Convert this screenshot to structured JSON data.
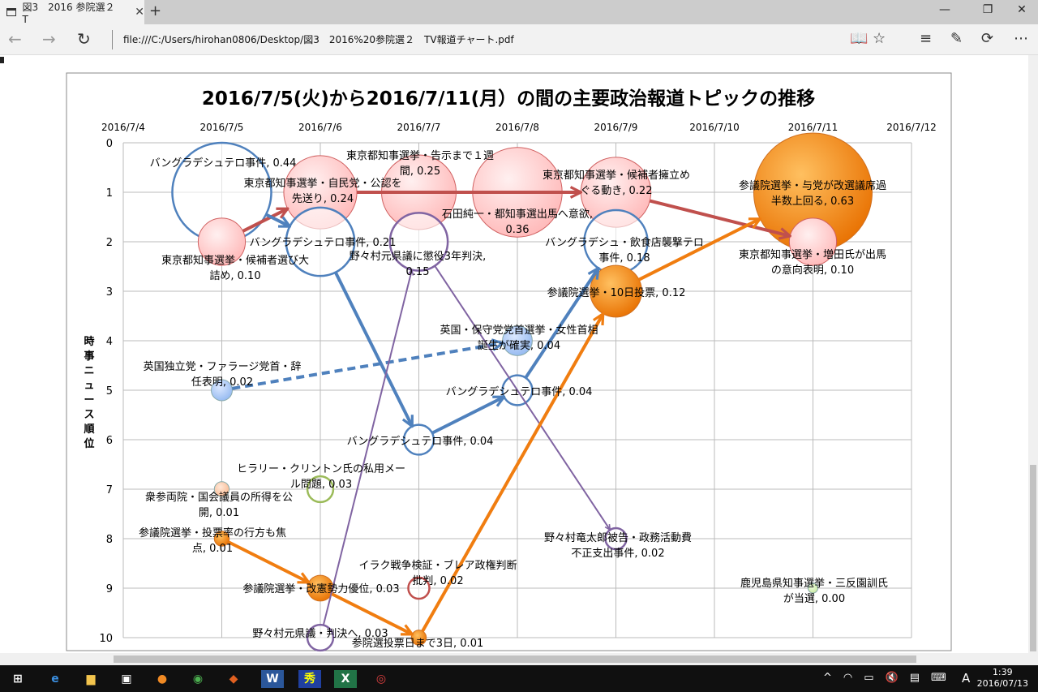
{
  "browser": {
    "tab_title": "図3　2016 参院選２　T",
    "url": "file:///C:/Users/hirohan0806/Desktop/図3　2016%20参院選２　TV報道チャート.pdf",
    "icons": [
      "tab-icon",
      "close-icon",
      "new-tab-icon",
      "minimize-icon",
      "maximize-icon",
      "close-window-icon",
      "back-icon",
      "forward-icon",
      "refresh-icon",
      "reading-view-icon",
      "favorite-star-icon",
      "hub-icon",
      "web-note-icon",
      "share-icon",
      "more-icon"
    ]
  },
  "taskbar": {
    "time": "1:39",
    "date": "2016/07/13",
    "ime": "A",
    "apps": [
      "start",
      "edge",
      "file-explorer",
      "store",
      "firefox",
      "chrome",
      "app",
      "word",
      "app",
      "excel",
      "app"
    ]
  },
  "chart_data": {
    "type": "bubble",
    "title": "2016/7/5(火)から2016/7/11(月）の間の主要政治報道トピックの推移",
    "ylabel": "時事ニュース順位",
    "xlabel": "",
    "x_ticks": [
      "2016/7/4",
      "2016/7/5",
      "2016/7/6",
      "2016/7/7",
      "2016/7/8",
      "2016/7/9",
      "2016/7/10",
      "2016/7/11",
      "2016/7/12"
    ],
    "y_ticks": [
      "0",
      "1",
      "2",
      "3",
      "4",
      "5",
      "6",
      "7",
      "8",
      "9",
      "10"
    ],
    "xlim": [
      "2016/7/4",
      "2016/7/12"
    ],
    "ylim": [
      0,
      10
    ],
    "y_reversed": true,
    "grid": true,
    "colors": {
      "red": "#c0504d",
      "pink": "#ffc7c7",
      "blue": "#4f81bd",
      "lightblue": "#a8c8f8",
      "purple": "#8064a2",
      "orange": "#f07d10",
      "lightorange": "#fbc8a0",
      "green": "#9bbb59",
      "lightgreen": "#d7f0b0"
    },
    "points": [
      {
        "date": "2016/7/5",
        "rank": 1,
        "value": 0.44,
        "style": "blue-outline",
        "label": [
          "バングラデシュテロ事件, 0.44"
        ]
      },
      {
        "date": "2016/7/5",
        "rank": 2,
        "value": 0.1,
        "style": "pink",
        "label": [
          "東京都知事選挙・候補者選び大",
          "詰め, 0.10"
        ]
      },
      {
        "date": "2016/7/6",
        "rank": 1,
        "value": 0.24,
        "style": "pink",
        "label": [
          "東京都知事選挙・自民党・公認を",
          "先送り, 0.24"
        ]
      },
      {
        "date": "2016/7/6",
        "rank": 2,
        "value": 0.21,
        "style": "blue-outline",
        "label": [
          "バングラデシュテロ事件, 0.21"
        ]
      },
      {
        "date": "2016/7/7",
        "rank": 1,
        "value": 0.25,
        "style": "pink",
        "label": [
          "東京都知事選挙・告示まで１週",
          "間, 0.25"
        ]
      },
      {
        "date": "2016/7/7",
        "rank": 2,
        "value": 0.15,
        "style": "purple-outline",
        "label": [
          "野々村元県議に懲役3年判決,",
          "0.15"
        ]
      },
      {
        "date": "2016/7/8",
        "rank": 1,
        "value": 0.36,
        "style": "pink",
        "label": [
          "石田純一・都知事選出馬へ意欲,",
          "0.36"
        ]
      },
      {
        "date": "2016/7/9",
        "rank": 1,
        "value": 0.22,
        "style": "pink",
        "label": [
          "東京都知事選挙・候補者擁立め",
          "ぐる動き, 0.22"
        ]
      },
      {
        "date": "2016/7/9",
        "rank": 2,
        "value": 0.18,
        "style": "blue-outline",
        "label": [
          "バングラデシュ・飲食店襲撃テロ",
          "事件, 0.18"
        ]
      },
      {
        "date": "2016/7/9",
        "rank": 3,
        "value": 0.12,
        "style": "orange",
        "label": [
          "参議院選挙・10日投票, 0.12"
        ]
      },
      {
        "date": "2016/7/11",
        "rank": 1,
        "value": 0.63,
        "style": "orange",
        "label": [
          "参議院選挙・与党が改選議席過",
          "半数上回る, 0.63"
        ]
      },
      {
        "date": "2016/7/11",
        "rank": 2,
        "value": 0.1,
        "style": "pink",
        "label": [
          "東京都知事選挙・増田氏が出馬",
          "の意向表明, 0.10"
        ]
      },
      {
        "date": "2016/7/8",
        "rank": 4,
        "value": 0.04,
        "style": "lightblue",
        "label": [
          "英国・保守党党首選挙・女性首相",
          "誕生が確実, 0.04"
        ]
      },
      {
        "date": "2016/7/5",
        "rank": 5,
        "value": 0.02,
        "style": "lightblue",
        "label": [
          "英国独立党・ファラージ党首・辞",
          "任表明, 0.02"
        ]
      },
      {
        "date": "2016/7/8",
        "rank": 5,
        "value": 0.04,
        "style": "blue-outline",
        "label": [
          "バングラデシュテロ事件, 0.04"
        ]
      },
      {
        "date": "2016/7/7",
        "rank": 6,
        "value": 0.04,
        "style": "blue-outline",
        "label": [
          "バングラデシュテロ事件, 0.04"
        ]
      },
      {
        "date": "2016/7/6",
        "rank": 7,
        "value": 0.03,
        "style": "green-outline",
        "label": [
          "ヒラリー・クリントン氏の私用メー",
          "ル問題, 0.03"
        ]
      },
      {
        "date": "2016/7/5",
        "rank": 7,
        "value": 0.01,
        "style": "lightorange",
        "label": [
          "衆参両院・国会議員の所得を公",
          "開, 0.01"
        ]
      },
      {
        "date": "2016/7/5",
        "rank": 8,
        "value": 0.01,
        "style": "orange",
        "label": [
          "参議院選挙・投票率の行方も焦",
          "点, 0.01"
        ]
      },
      {
        "date": "2016/7/6",
        "rank": 9,
        "value": 0.03,
        "style": "orange",
        "label": [
          "参議院選挙・改憲勢力優位, 0.03"
        ]
      },
      {
        "date": "2016/7/7",
        "rank": 9,
        "value": 0.02,
        "style": "red-outline",
        "label": [
          "イラク戦争検証・ブレア政権判断",
          "批判, 0.02"
        ]
      },
      {
        "date": "2016/7/6",
        "rank": 10,
        "value": 0.03,
        "style": "purple-outline",
        "label": [
          "野々村元県議・判決へ, 0.03"
        ]
      },
      {
        "date": "2016/7/7",
        "rank": 10,
        "value": 0.01,
        "style": "orange",
        "label": [
          "参院選投票日まで3日, 0.01"
        ]
      },
      {
        "date": "2016/7/9",
        "rank": 8,
        "value": 0.02,
        "style": "purple-outline",
        "label": [
          "野々村竜太郎被告・政務活動費",
          "不正支出事件, 0.02"
        ]
      },
      {
        "date": "2016/7/11",
        "rank": 9,
        "value": 0.0,
        "style": "lightgreen",
        "label": [
          "鹿児島県知事選挙・三反園訓氏",
          "が当選, 0.00"
        ]
      }
    ],
    "arrows": [
      {
        "from": 1,
        "to": 2,
        "color": "red"
      },
      {
        "from": 2,
        "to": 7,
        "color": "red"
      },
      {
        "from": 7,
        "to": 11,
        "color": "red"
      },
      {
        "from": 0,
        "to": 3,
        "color": "blue"
      },
      {
        "from": 3,
        "to": 15,
        "color": "blue"
      },
      {
        "from": 15,
        "to": 14,
        "color": "blue"
      },
      {
        "from": 14,
        "to": 8,
        "color": "blue"
      },
      {
        "from": 13,
        "to": 12,
        "color": "blue",
        "dashed": true
      },
      {
        "from": 21,
        "to": 5,
        "color": "purple"
      },
      {
        "from": 5,
        "to": 23,
        "color": "purple"
      },
      {
        "from": 18,
        "to": 19,
        "color": "orange"
      },
      {
        "from": 19,
        "to": 22,
        "color": "orange"
      },
      {
        "from": 22,
        "to": 9,
        "color": "orange"
      },
      {
        "from": 9,
        "to": 10,
        "color": "orange"
      }
    ]
  }
}
